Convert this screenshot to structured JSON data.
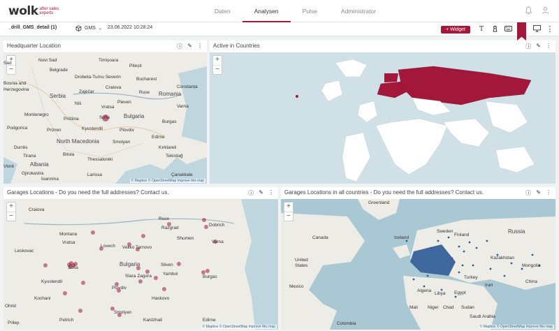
{
  "logo": {
    "main": "wolk",
    "sub_line1": "after sales",
    "sub_line2": "experts"
  },
  "nav": [
    {
      "label": "Daten",
      "active": false
    },
    {
      "label": "Analysen",
      "active": true
    },
    {
      "label": "Pulse",
      "active": false
    },
    {
      "label": "Administrator",
      "active": false
    }
  ],
  "toolbar": {
    "dashboard_title": "_drill_GMS_detail (1)",
    "source": "GMS",
    "timestamp": "23.06.2022 10:28:24",
    "widget_label": "+ Widget",
    "text_icon": "T"
  },
  "attribution": "© Mapbox © OpenStreetMap Improve this map",
  "zoom": {
    "in": "+",
    "out": "−"
  },
  "panels": {
    "hq": {
      "title": "Headquarter Location",
      "labels": [
        "Sad",
        "Novi Sad",
        "Belgrade",
        "Timișoara",
        "Drobeta-Turnu Severin",
        "Pitești",
        "Bucharest",
        "Constanța",
        "Craiova",
        "Bosnia and Herzegovina",
        "Zaječar",
        "Ruse",
        "Serbia",
        "Romania",
        "Niš",
        "Vratsa",
        "Pleven",
        "Varna",
        "Montenegro",
        "Sofia",
        "Bulgaria",
        "Burgas",
        "Priština",
        "Kyustendil",
        "Plovdiv",
        "Podgorica",
        "Prizren",
        "North Macedonia",
        "Durrës",
        "Smolyan",
        "Edirne",
        "Tirana",
        "Bitola",
        "Thessaloniki",
        "Kırklareli",
        "Tekirdağ",
        "Albania",
        "Vlorë",
        "Gjirokastra",
        "Ioannina",
        "Larissa",
        "Çanakkale"
      ]
    },
    "countries": {
      "title": "Active in Countries"
    },
    "garages": {
      "title": "Garages Locations - Do you need the full addresses? Contact us.",
      "labels": [
        "Craiova",
        "Ruse",
        "Razgrad",
        "Dobrich",
        "Montana",
        "Vratsa",
        "Lovech",
        "Veliko Tarnovo",
        "Shumen",
        "Varna",
        "Leskovac",
        "Bulgaria",
        "Sliven",
        "Burgas",
        "Sofia",
        "Stara Zagora",
        "Yambol",
        "Kyustendil",
        "Plovdiv",
        "Kochani",
        "Haskovo",
        "Ohrid",
        "Smolyan",
        "Prilep",
        "Petrich",
        "Kardzhali",
        "Edirne"
      ]
    },
    "garages_all": {
      "title": "Garages Locations in all countries - Do you need the full addresses? Contact us.",
      "labels": [
        "Greenland",
        "Canada",
        "United States",
        "Mexico",
        "Iceland",
        "Sweden",
        "Finland",
        "Russia",
        "Kazakhstan",
        "Turkey",
        "Iran",
        "Algeria",
        "Libya",
        "Egypt",
        "Niger",
        "Chad",
        "Sudan",
        "Colombia",
        "Mali",
        "Mongolia",
        "China",
        "Saudi Arabia"
      ]
    }
  },
  "colors": {
    "accent": "#a3173b",
    "sea": "#d6e3e6",
    "land": "#f3f1ec",
    "dots": "#a3173b",
    "blue_dots": "#2b5a96",
    "country_active": "#a3173b"
  }
}
